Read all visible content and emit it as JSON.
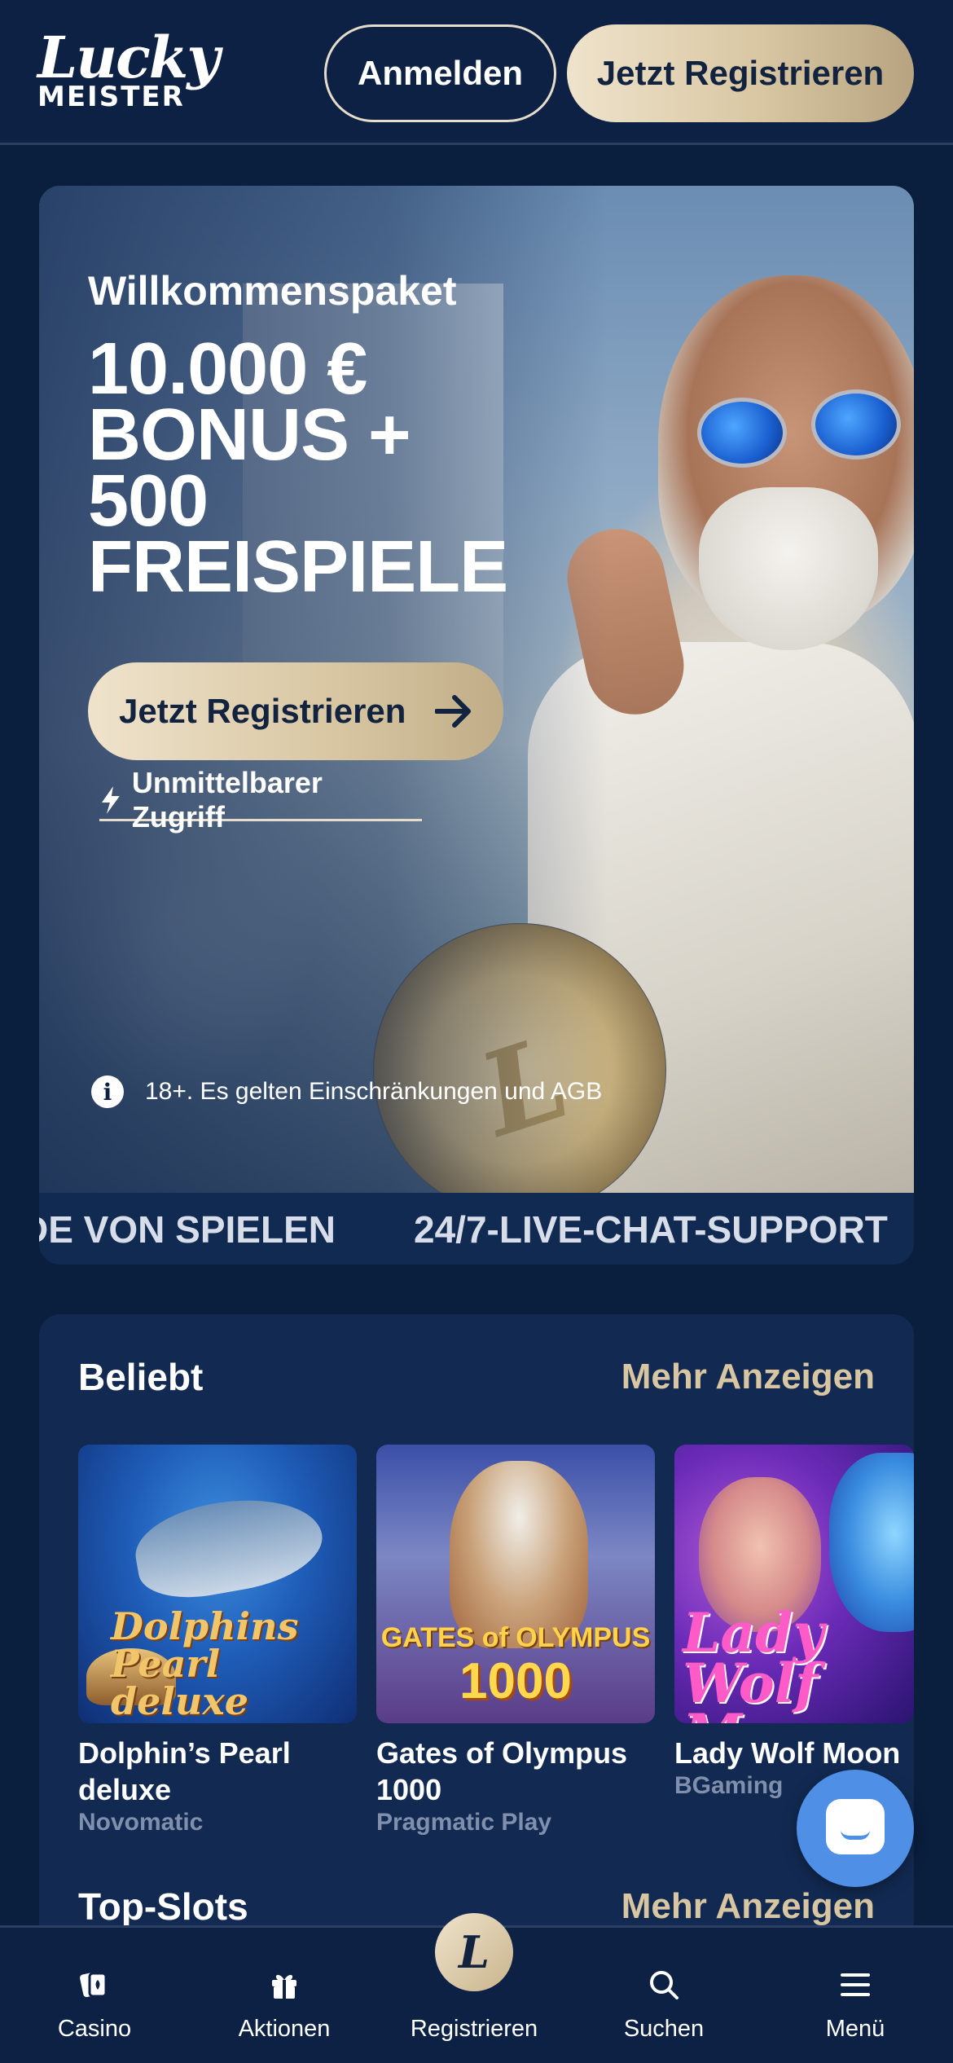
{
  "header": {
    "logo_line1": "Lucky",
    "logo_line2": "MEISTER",
    "login_label": "Anmelden",
    "register_label": "Jetzt Registrieren"
  },
  "hero": {
    "subtitle": "Willkommenspaket",
    "title": "10.000 € BONUS + 500 FREISPIELE",
    "cta_label": "Jetzt Registrieren",
    "instant_access": "Unmittelbarer Zugriff",
    "disclaimer": "18+. Es gelten Einschränkungen und AGB",
    "ticker": [
      "DE VON SPIELEN",
      "24/7-LIVE-CHAT-SUPPORT"
    ]
  },
  "popular": {
    "title": "Beliebt",
    "more": "Mehr Anzeigen",
    "games": [
      {
        "name": "Dolphin’s Pearl deluxe",
        "provider": "Novomatic",
        "art_text": "Dolphins Pearl deluxe"
      },
      {
        "name": "Gates of Olympus 1000",
        "provider": "Pragmatic Play",
        "art_text_1": "GATES of OLYMPUS",
        "art_text_2": "1000"
      },
      {
        "name": "Lady Wolf Moon",
        "provider": "BGaming",
        "art_text": "Lady Wolf Moon"
      }
    ]
  },
  "top_slots": {
    "title": "Top-Slots",
    "more": "Mehr Anzeigen"
  },
  "bottom_nav": {
    "items": [
      {
        "label": "Casino",
        "icon": "cards-icon"
      },
      {
        "label": "Aktionen",
        "icon": "gift-icon"
      },
      {
        "label": "Registrieren",
        "icon": "lucky-logo-icon"
      },
      {
        "label": "Suchen",
        "icon": "search-icon"
      },
      {
        "label": "Menü",
        "icon": "menu-icon"
      }
    ]
  },
  "colors": {
    "background": "#0a1e3e",
    "header": "#0c2144",
    "card": "#122a52",
    "accent_gold": "#d8c6a2",
    "chat_blue": "#4f8fe6"
  }
}
